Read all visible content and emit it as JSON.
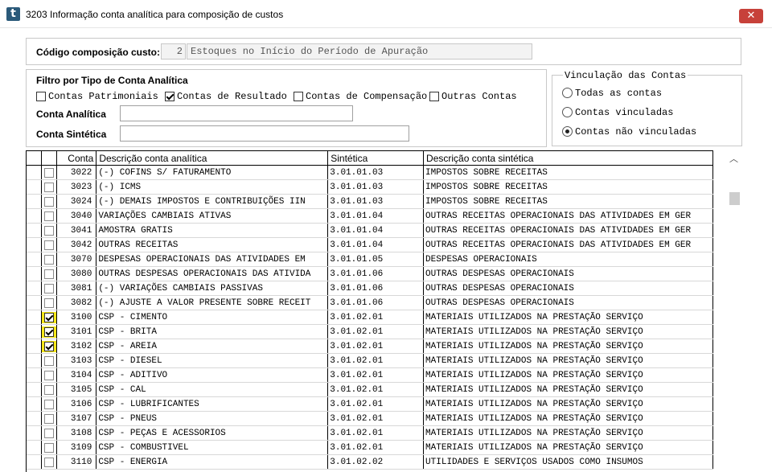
{
  "window": {
    "title": "3203 Informação conta analítica para composição de custos",
    "close_label": "✕"
  },
  "header": {
    "codigo_label": "Código composição custo:",
    "codigo_value": "2",
    "codigo_desc": "Estoques no Início do Período de Apuração"
  },
  "filtro": {
    "title": "Filtro por Tipo de Conta Analítica",
    "options": [
      {
        "label": "Contas Patrimoniais",
        "checked": false
      },
      {
        "label": "Contas de Resultado",
        "checked": true
      },
      {
        "label": "Contas de Compensação",
        "checked": false
      },
      {
        "label": "Outras Contas",
        "checked": false
      }
    ],
    "analitica_label": "Conta Analítica",
    "analitica_value": "",
    "sintetica_label": "Conta Sintética",
    "sintetica_value": ""
  },
  "vinculacao": {
    "title": "Vinculação das Contas",
    "options": [
      {
        "label": "Todas as contas",
        "selected": false
      },
      {
        "label": "Contas vinculadas",
        "selected": false
      },
      {
        "label": "Contas não vinculadas",
        "selected": true
      }
    ]
  },
  "grid": {
    "columns": [
      "",
      "",
      "Conta",
      "Descrição conta analítica",
      "Sintética",
      "Descrição conta sintética"
    ],
    "highlight_color": "#f6e81a",
    "rows": [
      {
        "checked": false,
        "highlight": false,
        "conta": "3022",
        "desc": "(-) COFINS S/ FATURAMENTO",
        "sintetica": "3.01.01.03",
        "desc_sint": "IMPOSTOS SOBRE RECEITAS"
      },
      {
        "checked": false,
        "highlight": false,
        "conta": "3023",
        "desc": "(-) ICMS",
        "sintetica": "3.01.01.03",
        "desc_sint": "IMPOSTOS SOBRE RECEITAS"
      },
      {
        "checked": false,
        "highlight": false,
        "conta": "3024",
        "desc": "(-) DEMAIS IMPOSTOS E  CONTRIBUIÇÕES IIN",
        "sintetica": "3.01.01.03",
        "desc_sint": "IMPOSTOS SOBRE RECEITAS"
      },
      {
        "checked": false,
        "highlight": false,
        "conta": "3040",
        "desc": "VARIAÇÕES CAMBIAIS ATIVAS",
        "sintetica": "3.01.01.04",
        "desc_sint": "OUTRAS RECEITAS OPERACIONAIS DAS ATIVIDADES EM GER"
      },
      {
        "checked": false,
        "highlight": false,
        "conta": "3041",
        "desc": "AMOSTRA GRATIS",
        "sintetica": "3.01.01.04",
        "desc_sint": "OUTRAS RECEITAS OPERACIONAIS DAS ATIVIDADES EM GER"
      },
      {
        "checked": false,
        "highlight": false,
        "conta": "3042",
        "desc": "OUTRAS RECEITAS",
        "sintetica": "3.01.01.04",
        "desc_sint": "OUTRAS RECEITAS OPERACIONAIS DAS ATIVIDADES EM GER"
      },
      {
        "checked": false,
        "highlight": false,
        "conta": "3070",
        "desc": "DESPESAS OPERACIONAIS DAS ATIVIDADES EM",
        "sintetica": "3.01.01.05",
        "desc_sint": "DESPESAS OPERACIONAIS"
      },
      {
        "checked": false,
        "highlight": false,
        "conta": "3080",
        "desc": "OUTRAS DESPESAS OPERACIONAIS DAS ATIVIDA",
        "sintetica": "3.01.01.06",
        "desc_sint": "OUTRAS DESPESAS OPERACIONAIS"
      },
      {
        "checked": false,
        "highlight": false,
        "conta": "3081",
        "desc": "(-) VARIAÇÕES CAMBIAIS PASSIVAS",
        "sintetica": "3.01.01.06",
        "desc_sint": "OUTRAS DESPESAS OPERACIONAIS"
      },
      {
        "checked": false,
        "highlight": false,
        "conta": "3082",
        "desc": "(-) AJUSTE A VALOR PRESENTE SOBRE RECEIT",
        "sintetica": "3.01.01.06",
        "desc_sint": "OUTRAS DESPESAS OPERACIONAIS"
      },
      {
        "checked": true,
        "highlight": true,
        "conta": "3100",
        "desc": "CSP - CIMENTO",
        "sintetica": "3.01.02.01",
        "desc_sint": "MATERIAIS UTILIZADOS NA PRESTAÇÃO SERVIÇO"
      },
      {
        "checked": true,
        "highlight": true,
        "conta": "3101",
        "desc": "CSP - BRITA",
        "sintetica": "3.01.02.01",
        "desc_sint": "MATERIAIS UTILIZADOS NA PRESTAÇÃO SERVIÇO"
      },
      {
        "checked": true,
        "highlight": true,
        "conta": "3102",
        "desc": "CSP - AREIA",
        "sintetica": "3.01.02.01",
        "desc_sint": "MATERIAIS UTILIZADOS NA PRESTAÇÃO SERVIÇO"
      },
      {
        "checked": false,
        "highlight": false,
        "conta": "3103",
        "desc": "CSP - DIESEL",
        "sintetica": "3.01.02.01",
        "desc_sint": "MATERIAIS UTILIZADOS NA PRESTAÇÃO SERVIÇO"
      },
      {
        "checked": false,
        "highlight": false,
        "conta": "3104",
        "desc": "CSP - ADITIVO",
        "sintetica": "3.01.02.01",
        "desc_sint": "MATERIAIS UTILIZADOS NA PRESTAÇÃO SERVIÇO"
      },
      {
        "checked": false,
        "highlight": false,
        "conta": "3105",
        "desc": "CSP - CAL",
        "sintetica": "3.01.02.01",
        "desc_sint": "MATERIAIS UTILIZADOS NA PRESTAÇÃO SERVIÇO"
      },
      {
        "checked": false,
        "highlight": false,
        "conta": "3106",
        "desc": "CSP - LUBRIFICANTES",
        "sintetica": "3.01.02.01",
        "desc_sint": "MATERIAIS UTILIZADOS NA PRESTAÇÃO SERVIÇO"
      },
      {
        "checked": false,
        "highlight": false,
        "conta": "3107",
        "desc": "CSP - PNEUS",
        "sintetica": "3.01.02.01",
        "desc_sint": "MATERIAIS UTILIZADOS NA PRESTAÇÃO SERVIÇO"
      },
      {
        "checked": false,
        "highlight": false,
        "conta": "3108",
        "desc": "CSP - PEÇAS E ACESSORIOS",
        "sintetica": "3.01.02.01",
        "desc_sint": "MATERIAIS UTILIZADOS NA PRESTAÇÃO SERVIÇO"
      },
      {
        "checked": false,
        "highlight": false,
        "conta": "3109",
        "desc": "CSP - COMBUSTIVEL",
        "sintetica": "3.01.02.01",
        "desc_sint": "MATERIAIS UTILIZADOS NA PRESTAÇÃO SERVIÇO"
      },
      {
        "checked": false,
        "highlight": false,
        "conta": "3110",
        "desc": "CSP - ENERGIA",
        "sintetica": "3.01.02.02",
        "desc_sint": "UTILIDADES E SERVIÇOS USADOS COMO INSUMOS"
      }
    ]
  },
  "icons": {
    "app": "app-logo-icon",
    "close": "close-icon",
    "scroll_up": "scroll-up-arrow-icon"
  }
}
